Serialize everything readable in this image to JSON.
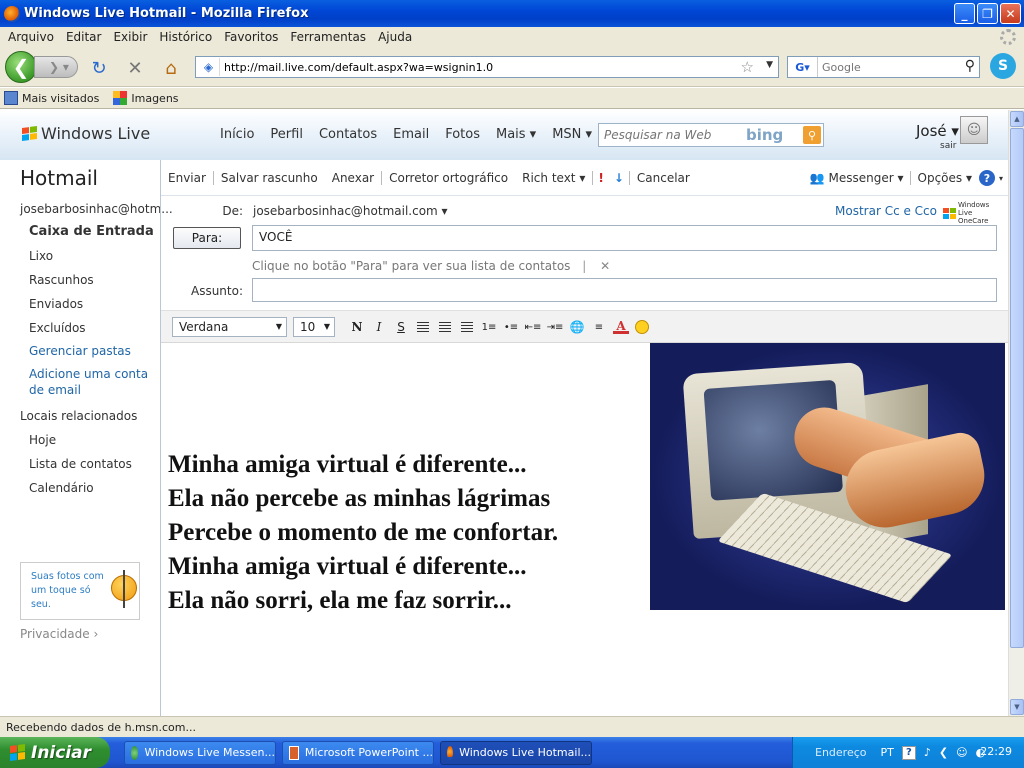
{
  "window": {
    "title": "Windows Live Hotmail - Mozilla Firefox",
    "buttons": [
      "_",
      "❐",
      "✕"
    ]
  },
  "menu": [
    "Arquivo",
    "Editar",
    "Exibir",
    "Histórico",
    "Favoritos",
    "Ferramentas",
    "Ajuda"
  ],
  "nav": {
    "url": "http://mail.live.com/default.aspx?wa=wsignin1.0",
    "search_placeholder": "Google"
  },
  "bookmarks": [
    "Mais visitados",
    "Imagens"
  ],
  "wl": {
    "logo": "Windows Live",
    "nav": [
      "Início",
      "Perfil",
      "Contatos",
      "Email",
      "Fotos",
      "Mais ▾",
      "MSN ▾"
    ],
    "search_placeholder": "Pesquisar na Web",
    "search_brand": "bing",
    "user": "José ▾",
    "signout": "sair"
  },
  "sidebar": {
    "title": "Hotmail",
    "account": "josebarbosinhac@hotm...",
    "folders": [
      "Caixa de Entrada",
      "Lixo",
      "Rascunhos",
      "Enviados",
      "Excluídos"
    ],
    "manage": "Gerenciar pastas",
    "add_account": "Adicione uma conta de email",
    "related_header": "Locais relacionados",
    "related": [
      "Hoje",
      "Lista de contatos",
      "Calendário"
    ],
    "ad_text": "Suas fotos com um toque só seu.",
    "privacy": "Privacidade"
  },
  "toolbar": {
    "send": "Enviar",
    "save_draft": "Salvar rascunho",
    "attach": "Anexar",
    "spell": "Corretor ortográfico",
    "rich_text": "Rich text ▾",
    "cancel": "Cancelar",
    "messenger": "Messenger ▾",
    "options": "Opções ▾",
    "help": "?"
  },
  "compose": {
    "from_label": "De:",
    "from_value": "josebarbosinhac@hotmail.com ▾",
    "show_cc": "Mostrar Cc e Cco",
    "onecare": "Windows Live OneCare",
    "to_button": "Para:",
    "to_value": "VOCÊ",
    "hint": "Clique no botão \"Para\" para ver sua lista de contatos",
    "subject_label": "Assunto:",
    "subject_value": "",
    "font": "Verdana",
    "size": "10",
    "poem": [
      "Minha amiga virtual é diferente...",
      "Ela não percebe as minhas lágrimas",
      "Percebe o momento de me confortar.",
      "Minha amiga virtual é diferente...",
      "Ela não sorri, ela me faz sorrir..."
    ]
  },
  "status": "Recebendo dados de h.msn.com...",
  "taskbar": {
    "start": "Iniciar",
    "tasks": [
      "Windows Live Messen...",
      "Microsoft PowerPoint ...",
      "Windows Live Hotmail..."
    ],
    "address": "Endereço",
    "lang": "PT",
    "time": "22:29"
  }
}
